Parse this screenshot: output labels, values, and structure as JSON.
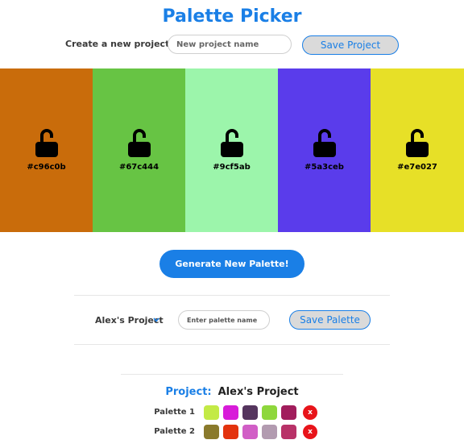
{
  "header": {
    "title": "Palette Picker"
  },
  "create_project": {
    "label": "Create a new project:",
    "placeholder": "New project name",
    "save_label": "Save Project"
  },
  "palette": [
    {
      "hex": "#c96c0b",
      "color": "#c96c0b",
      "icon": "unlocked-padlock-icon"
    },
    {
      "hex": "#67c444",
      "color": "#67c444",
      "icon": "unlocked-padlock-icon"
    },
    {
      "hex": "#9cf5ab",
      "color": "#9cf5ab",
      "icon": "unlocked-padlock-icon"
    },
    {
      "hex": "#5a3ceb",
      "color": "#5a3ceb",
      "icon": "unlocked-padlock-icon"
    },
    {
      "hex": "#e7e027",
      "color": "#e7e027",
      "icon": "unlocked-padlock-icon"
    }
  ],
  "generate": {
    "label": "Generate New Palette!"
  },
  "save_palette": {
    "project_select": "Alex's Project",
    "placeholder": "Enter palette name",
    "save_label": "Save Palette"
  },
  "projects": {
    "label": "Project:",
    "name": "Alex's Project",
    "palettes": [
      {
        "name": "Palette 1",
        "colors": [
          "#c3ea46",
          "#d81bd9",
          "#55355e",
          "#8ed73c",
          "#a11d5c"
        ],
        "delete_label": "x"
      },
      {
        "name": "Palette 2",
        "colors": [
          "#8a7a2c",
          "#e3330e",
          "#d15ec6",
          "#b29bb0",
          "#b83268"
        ],
        "delete_label": "x"
      }
    ]
  },
  "colors": {
    "accent": "#1a7fe6",
    "delete": "#e8141a",
    "button_bg": "#dadada"
  }
}
